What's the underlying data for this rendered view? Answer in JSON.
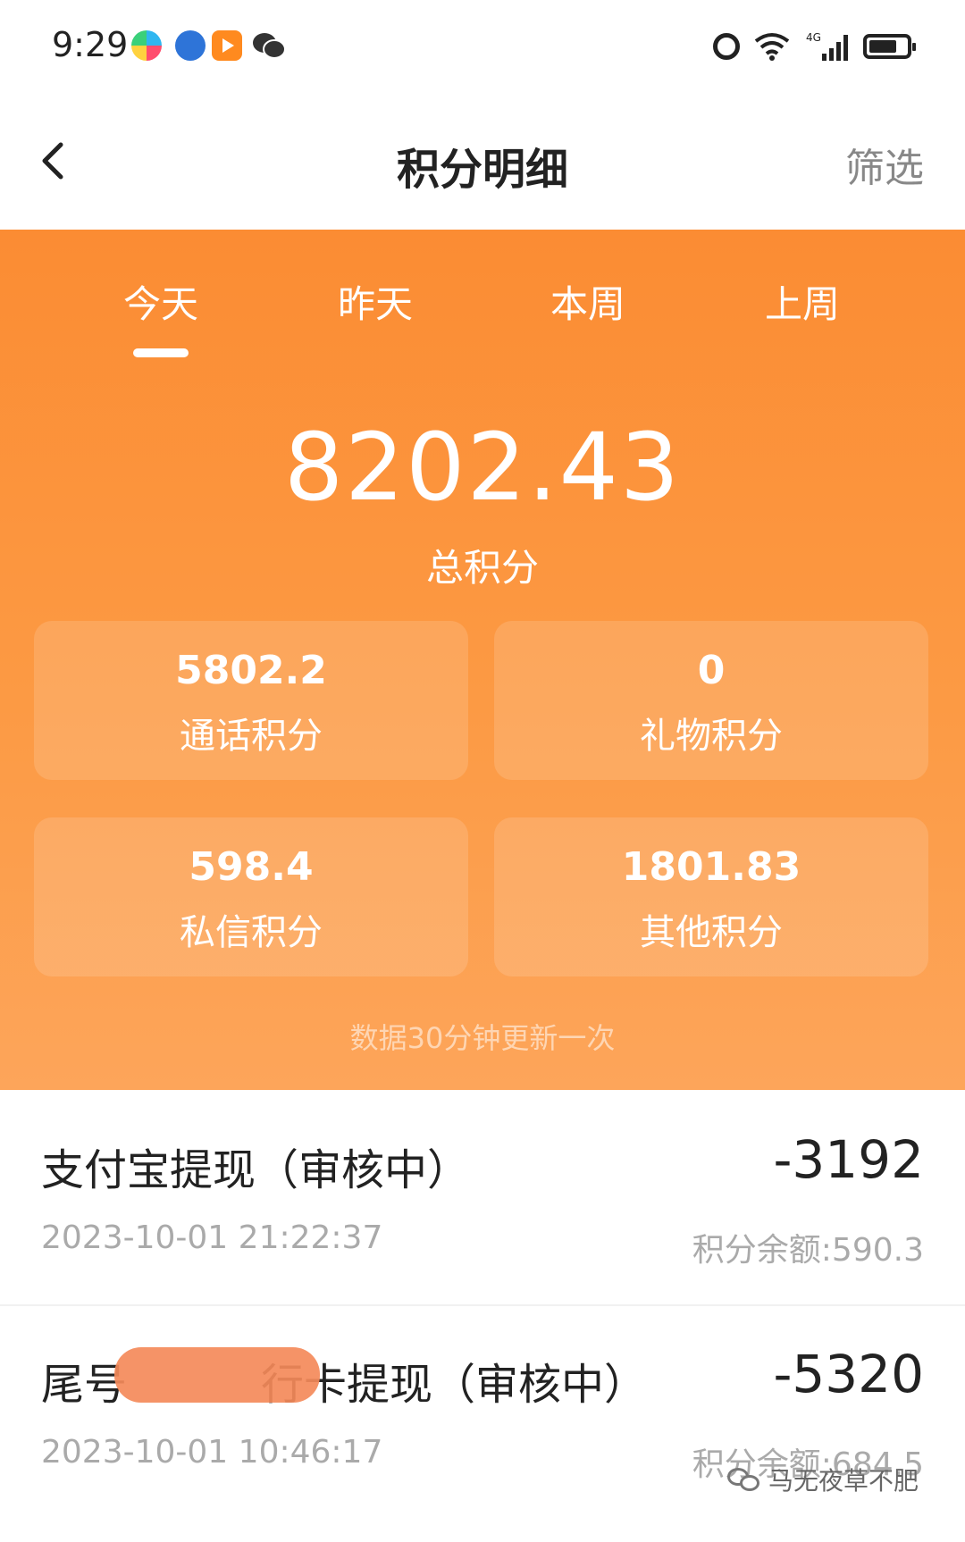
{
  "status_bar": {
    "time": "9:29",
    "left_icons": [
      "app-icon-colorful",
      "browser-icon",
      "video-app-icon",
      "wechat-icon"
    ],
    "right_icons": [
      "alarm-icon",
      "wifi-icon",
      "4g-signal-icon",
      "battery-icon"
    ],
    "network": "4G"
  },
  "nav": {
    "title": "积分明细",
    "filter_label": "筛选",
    "back_icon": "chevron-left-icon"
  },
  "tabs": [
    {
      "label": "今天",
      "active": true
    },
    {
      "label": "昨天",
      "active": false
    },
    {
      "label": "本周",
      "active": false
    },
    {
      "label": "上周",
      "active": false
    }
  ],
  "summary": {
    "total_value": "8202.43",
    "total_label": "总积分",
    "cards": [
      {
        "value": "5802.2",
        "label": "通话积分"
      },
      {
        "value": "0",
        "label": "礼物积分"
      },
      {
        "value": "598.4",
        "label": "私信积分"
      },
      {
        "value": "1801.83",
        "label": "其他积分"
      }
    ],
    "update_note": "数据30分钟更新一次"
  },
  "records": [
    {
      "title": "支付宝提现（审核中）",
      "time": "2023-10-01 21:22:37",
      "amount": "-3192",
      "balance": "积分余额:590.3"
    },
    {
      "title_prefix": "尾号",
      "title_suffix": "行卡提现（审核中）",
      "time": "2023-10-01 10:46:17",
      "amount": "-5320",
      "balance": "积分余额:684.5"
    }
  ],
  "watermark": "马无夜草不肥",
  "colors": {
    "panel_top": "#fb8c33",
    "panel_bottom": "#fda55a",
    "text_dark": "#222222",
    "text_muted": "#aaaaaa"
  }
}
